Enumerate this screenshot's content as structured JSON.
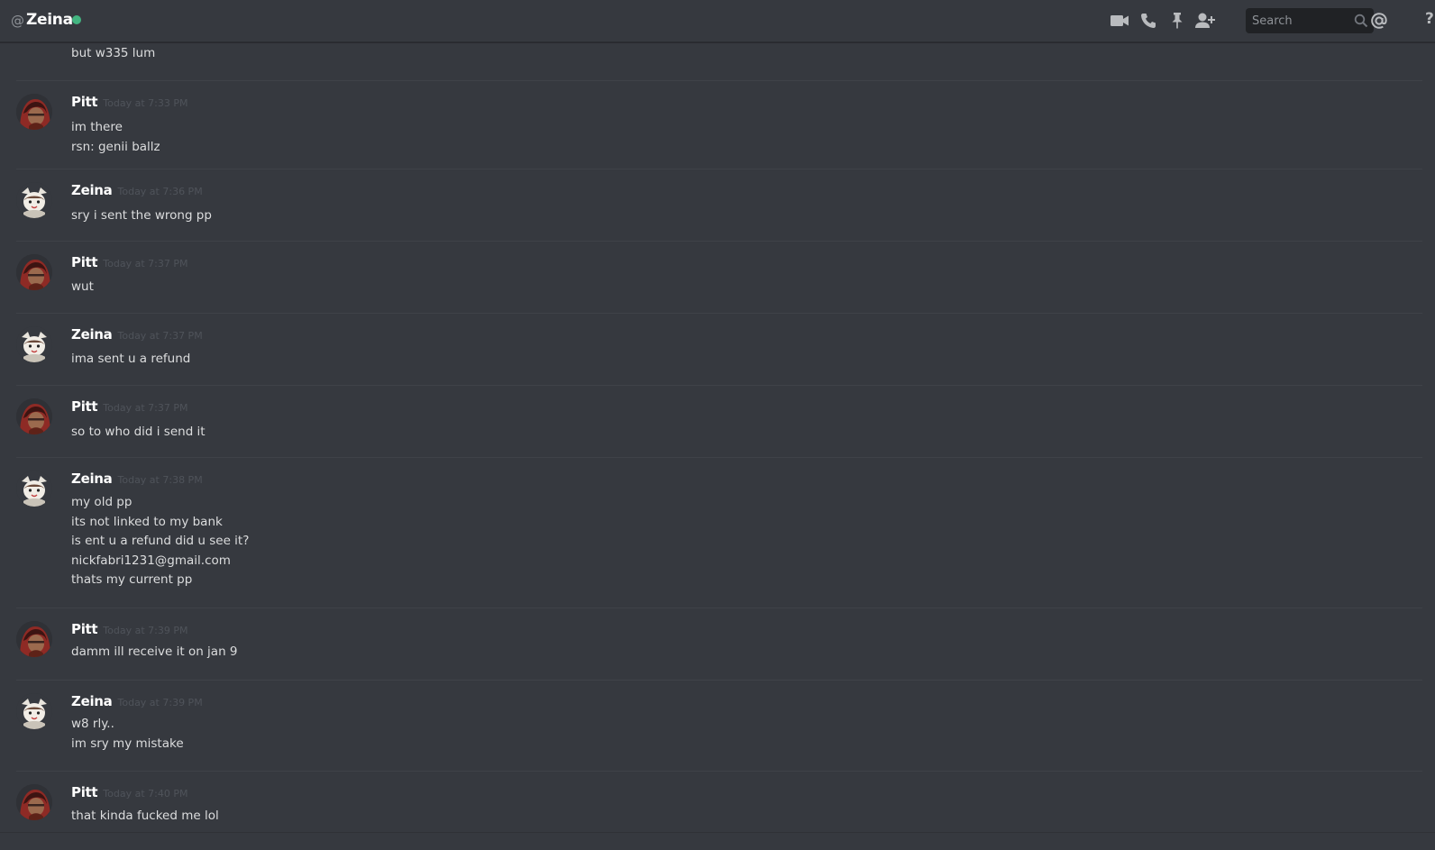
{
  "header": {
    "at_symbol": "@",
    "channel_name": "Zeina",
    "status_color": "#43b581",
    "icons": [
      "video-call-icon",
      "voice-call-icon",
      "pin-icon",
      "add-friend-icon",
      "mention-icon",
      "help-icon"
    ],
    "search_placeholder": "Search",
    "help_label": "?"
  },
  "top_fragment": {
    "lines": [
      "but w335 lum"
    ]
  },
  "messages": [
    {
      "author": "Pitt",
      "timestamp": "Today at 7:33 PM",
      "lines": [
        "im there",
        "rsn: genii ballz"
      ]
    },
    {
      "author": "Zeina",
      "timestamp": "Today at 7:36 PM",
      "lines": [
        "sry i sent the wrong pp"
      ]
    },
    {
      "author": "Pitt",
      "timestamp": "Today at 7:37 PM",
      "lines": [
        "wut"
      ]
    },
    {
      "author": "Zeina",
      "timestamp": "Today at 7:37 PM",
      "lines": [
        "ima sent u a refund"
      ]
    },
    {
      "author": "Pitt",
      "timestamp": "Today at 7:37 PM",
      "lines": [
        "so to who did i send it"
      ]
    },
    {
      "author": "Zeina",
      "timestamp": "Today at 7:38 PM",
      "lines": [
        "my old pp",
        "its not linked to my bank",
        "is  ent u a refund did u see it?",
        "nickfabri1231@gmail.com",
        "thats my current pp"
      ]
    },
    {
      "author": "Pitt",
      "timestamp": "Today at 7:39 PM",
      "lines": [
        "damm ill receive it on jan 9"
      ]
    },
    {
      "author": "Zeina",
      "timestamp": "Today at 7:39 PM",
      "lines": [
        "w8 rly..",
        "im sry my mistake"
      ]
    },
    {
      "author": "Pitt",
      "timestamp": "Today at 7:40 PM",
      "lines": [
        "that kinda fucked me lol"
      ]
    }
  ]
}
